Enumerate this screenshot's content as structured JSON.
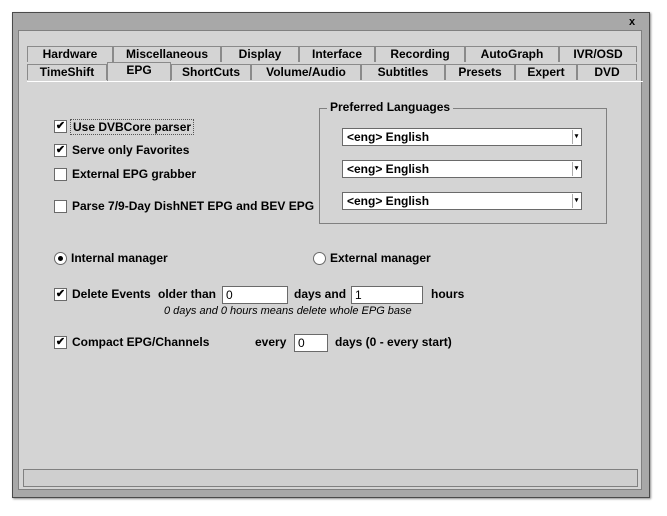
{
  "window": {
    "close_glyph": "x"
  },
  "tabs_row1": [
    "Hardware",
    "Miscellaneous",
    "Display",
    "Interface",
    "Recording",
    "AutoGraph",
    "IVR/OSD"
  ],
  "tabs_row2": [
    "TimeShift",
    "EPG",
    "ShortCuts",
    "Volume/Audio",
    "Subtitles",
    "Presets",
    "Expert",
    "DVD"
  ],
  "active_tab": "EPG",
  "options": {
    "use_dvbcore": {
      "label": "Use DVBCore parser",
      "checked": true
    },
    "serve_favorites": {
      "label": "Serve only Favorites",
      "checked": true
    },
    "external_grabber": {
      "label": "External EPG grabber",
      "checked": false
    },
    "parse_dishnet": {
      "label": "Parse 7/9-Day DishNET EPG and BEV EPG",
      "checked": false
    }
  },
  "preferred_languages": {
    "title": "Preferred Languages",
    "values": [
      "<eng> English",
      "<eng> English",
      "<eng> English"
    ]
  },
  "manager": {
    "internal_label": "Internal manager",
    "external_label": "External manager",
    "selected": "internal"
  },
  "delete_events": {
    "label": "Delete Events",
    "checked": true,
    "older_than_label": "older than",
    "days_value": "0",
    "days_and_label": "days and",
    "hours_value": "1",
    "hours_label": "hours",
    "note": "0 days and 0 hours means delete whole EPG base"
  },
  "compact": {
    "label": "Compact EPG/Channels",
    "checked": true,
    "every_label": "every",
    "value": "0",
    "days_label": "days (0 - every start)"
  },
  "icons": {
    "check": "✔",
    "dropdown": "▾"
  }
}
